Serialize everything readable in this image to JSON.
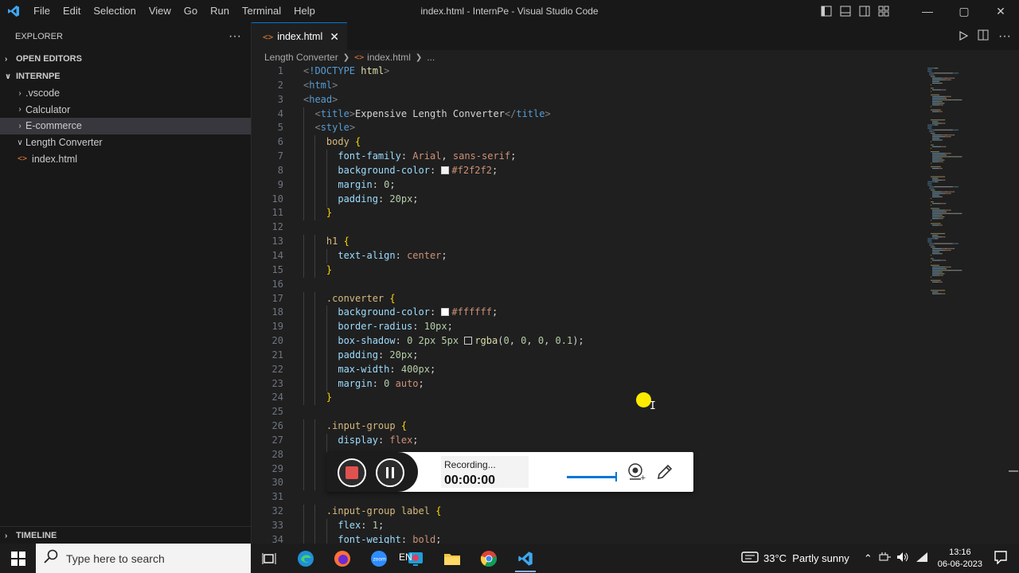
{
  "window": {
    "title": "index.html - InternPe - Visual Studio Code",
    "menu": [
      "File",
      "Edit",
      "Selection",
      "View",
      "Go",
      "Run",
      "Terminal",
      "Help"
    ],
    "controls": {
      "minimize": "—",
      "maximize": "▢",
      "close": "✕"
    }
  },
  "sidebar": {
    "header": "EXPLORER",
    "more": "···",
    "open_editors": "OPEN EDITORS",
    "project": "INTERNPE",
    "tree": [
      {
        "label": ".vscode",
        "chev": "›"
      },
      {
        "label": "Calculator",
        "chev": "›"
      },
      {
        "label": "E-commerce",
        "chev": "›"
      },
      {
        "label": "Length Converter",
        "chev": "∨"
      },
      {
        "label": "index.html",
        "chev": "<>"
      }
    ],
    "timeline": "TIMELINE"
  },
  "editor": {
    "tab": {
      "icon": "<>",
      "label": "index.html",
      "close": "✕"
    },
    "breadcrumb": {
      "folder": "Length Converter",
      "file": "index.html",
      "more": "..."
    },
    "code": [
      {
        "n": "1",
        "ind": 0,
        "t": [
          [
            "t-br",
            "<"
          ],
          [
            "t-doc",
            "!DOCTYPE "
          ],
          [
            "t-fn",
            "html"
          ],
          [
            "t-br",
            ">"
          ]
        ]
      },
      {
        "n": "2",
        "ind": 0,
        "t": [
          [
            "t-br",
            "<"
          ],
          [
            "t-tag",
            "html"
          ],
          [
            "t-br",
            ">"
          ]
        ]
      },
      {
        "n": "3",
        "ind": 0,
        "t": [
          [
            "t-br",
            "<"
          ],
          [
            "t-tag",
            "head"
          ],
          [
            "t-br",
            ">"
          ]
        ]
      },
      {
        "n": "4",
        "ind": 1,
        "t": [
          [
            "t-br",
            "<"
          ],
          [
            "t-tag",
            "title"
          ],
          [
            "t-br",
            ">"
          ],
          [
            "t-txt",
            "Expensive Length Converter"
          ],
          [
            "t-br",
            "</"
          ],
          [
            "t-tag",
            "title"
          ],
          [
            "t-br",
            ">"
          ]
        ]
      },
      {
        "n": "5",
        "ind": 1,
        "t": [
          [
            "t-br",
            "<"
          ],
          [
            "t-tag",
            "style"
          ],
          [
            "t-br",
            ">"
          ]
        ]
      },
      {
        "n": "6",
        "ind": 2,
        "t": [
          [
            "t-sel",
            "body "
          ],
          [
            "t-brace",
            "{"
          ]
        ]
      },
      {
        "n": "7",
        "ind": 3,
        "t": [
          [
            "t-prop",
            "font-family"
          ],
          [
            "t-txt",
            ": "
          ],
          [
            "t-val",
            "Arial"
          ],
          [
            "t-txt",
            ", "
          ],
          [
            "t-val",
            "sans-serif"
          ],
          [
            "t-txt",
            ";"
          ]
        ]
      },
      {
        "n": "8",
        "ind": 3,
        "t": [
          [
            "t-prop",
            "background-color"
          ],
          [
            "t-txt",
            ": "
          ],
          [
            "sw",
            "#f2f2f2"
          ],
          [
            "t-val",
            "#f2f2f2"
          ],
          [
            "t-txt",
            ";"
          ]
        ]
      },
      {
        "n": "9",
        "ind": 3,
        "t": [
          [
            "t-prop",
            "margin"
          ],
          [
            "t-txt",
            ": "
          ],
          [
            "t-num",
            "0"
          ],
          [
            "t-txt",
            ";"
          ]
        ]
      },
      {
        "n": "10",
        "ind": 3,
        "t": [
          [
            "t-prop",
            "padding"
          ],
          [
            "t-txt",
            ": "
          ],
          [
            "t-num",
            "20px"
          ],
          [
            "t-txt",
            ";"
          ]
        ]
      },
      {
        "n": "11",
        "ind": 2,
        "t": [
          [
            "t-brace",
            "}"
          ]
        ]
      },
      {
        "n": "12",
        "ind": 0,
        "t": []
      },
      {
        "n": "13",
        "ind": 2,
        "t": [
          [
            "t-sel",
            "h1 "
          ],
          [
            "t-brace",
            "{"
          ]
        ]
      },
      {
        "n": "14",
        "ind": 3,
        "t": [
          [
            "t-prop",
            "text-align"
          ],
          [
            "t-txt",
            ": "
          ],
          [
            "t-val",
            "center"
          ],
          [
            "t-txt",
            ";"
          ]
        ]
      },
      {
        "n": "15",
        "ind": 2,
        "t": [
          [
            "t-brace",
            "}"
          ]
        ]
      },
      {
        "n": "16",
        "ind": 0,
        "t": []
      },
      {
        "n": "17",
        "ind": 2,
        "t": [
          [
            "t-sel",
            ".converter "
          ],
          [
            "t-brace",
            "{"
          ]
        ]
      },
      {
        "n": "18",
        "ind": 3,
        "t": [
          [
            "t-prop",
            "background-color"
          ],
          [
            "t-txt",
            ": "
          ],
          [
            "sw",
            "#ffffff"
          ],
          [
            "t-val",
            "#ffffff"
          ],
          [
            "t-txt",
            ";"
          ]
        ]
      },
      {
        "n": "19",
        "ind": 3,
        "t": [
          [
            "t-prop",
            "border-radius"
          ],
          [
            "t-txt",
            ": "
          ],
          [
            "t-num",
            "10px"
          ],
          [
            "t-txt",
            ";"
          ]
        ]
      },
      {
        "n": "20",
        "ind": 3,
        "t": [
          [
            "t-prop",
            "box-shadow"
          ],
          [
            "t-txt",
            ": "
          ],
          [
            "t-num",
            "0 2px 5px "
          ],
          [
            "sw",
            "transparent"
          ],
          [
            "t-fn",
            "rgba"
          ],
          [
            "t-txt",
            "("
          ],
          [
            "t-num",
            "0"
          ],
          [
            "t-txt",
            ", "
          ],
          [
            "t-num",
            "0"
          ],
          [
            "t-txt",
            ", "
          ],
          [
            "t-num",
            "0"
          ],
          [
            "t-txt",
            ", "
          ],
          [
            "t-num",
            "0.1"
          ],
          [
            "t-txt",
            ");"
          ]
        ]
      },
      {
        "n": "21",
        "ind": 3,
        "t": [
          [
            "t-prop",
            "padding"
          ],
          [
            "t-txt",
            ": "
          ],
          [
            "t-num",
            "20px"
          ],
          [
            "t-txt",
            ";"
          ]
        ]
      },
      {
        "n": "22",
        "ind": 3,
        "t": [
          [
            "t-prop",
            "max-width"
          ],
          [
            "t-txt",
            ": "
          ],
          [
            "t-num",
            "400px"
          ],
          [
            "t-txt",
            ";"
          ]
        ]
      },
      {
        "n": "23",
        "ind": 3,
        "t": [
          [
            "t-prop",
            "margin"
          ],
          [
            "t-txt",
            ": "
          ],
          [
            "t-num",
            "0 "
          ],
          [
            "t-val",
            "auto"
          ],
          [
            "t-txt",
            ";"
          ]
        ]
      },
      {
        "n": "24",
        "ind": 2,
        "t": [
          [
            "t-brace",
            "}"
          ]
        ]
      },
      {
        "n": "25",
        "ind": 0,
        "t": []
      },
      {
        "n": "26",
        "ind": 2,
        "t": [
          [
            "t-sel",
            ".input-group "
          ],
          [
            "t-brace",
            "{"
          ]
        ]
      },
      {
        "n": "27",
        "ind": 3,
        "t": [
          [
            "t-prop",
            "display"
          ],
          [
            "t-txt",
            ": "
          ],
          [
            "t-val",
            "flex"
          ],
          [
            "t-txt",
            ";"
          ]
        ]
      },
      {
        "n": "28",
        "ind": 3,
        "t": []
      },
      {
        "n": "29",
        "ind": 3,
        "t": []
      },
      {
        "n": "30",
        "ind": 2,
        "t": []
      },
      {
        "n": "31",
        "ind": 0,
        "t": []
      },
      {
        "n": "32",
        "ind": 2,
        "t": [
          [
            "t-sel",
            ".input-group label "
          ],
          [
            "t-brace",
            "{"
          ]
        ]
      },
      {
        "n": "33",
        "ind": 3,
        "t": [
          [
            "t-prop",
            "flex"
          ],
          [
            "t-txt",
            ": "
          ],
          [
            "t-num",
            "1"
          ],
          [
            "t-txt",
            ";"
          ]
        ]
      },
      {
        "n": "34",
        "ind": 3,
        "t": [
          [
            "t-prop",
            "font-weight"
          ],
          [
            "t-txt",
            ": "
          ],
          [
            "t-val",
            "bold"
          ],
          [
            "t-txt",
            ";"
          ]
        ]
      }
    ]
  },
  "recorder": {
    "status": "Recording...",
    "time": "00:00:00",
    "volume": 1.0
  },
  "taskbar": {
    "search_placeholder": "Type here to search",
    "language": "EN",
    "weather": "33°C  Partly sunny",
    "time": "13:16",
    "date": "06-06-2023"
  }
}
